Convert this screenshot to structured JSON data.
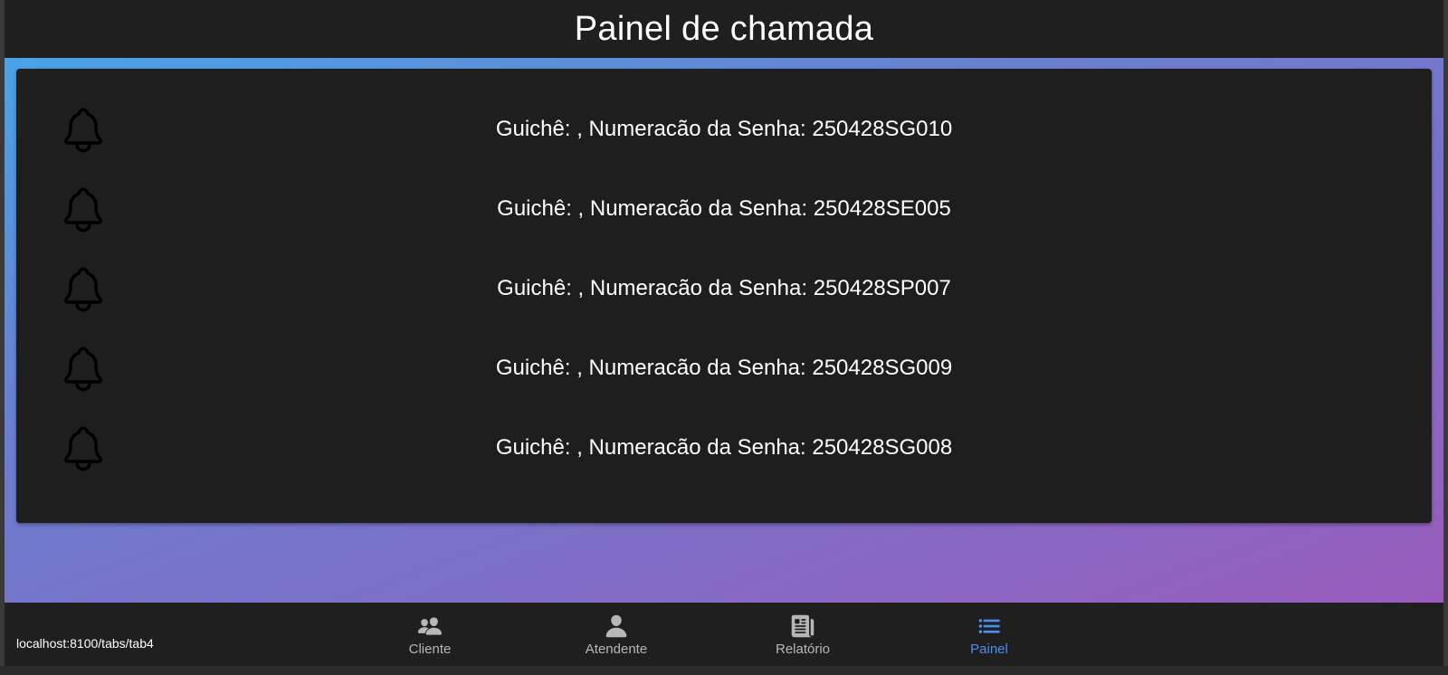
{
  "header": {
    "title": "Painel de chamada"
  },
  "calls": [
    {
      "text": "Guichê: , Numeracão da Senha: 250428SG010",
      "icon": "bell-icon"
    },
    {
      "text": "Guichê: , Numeracão da Senha: 250428SE005",
      "icon": "bell-icon"
    },
    {
      "text": "Guichê: , Numeracão da Senha: 250428SP007",
      "icon": "bell-icon"
    },
    {
      "text": "Guichê: , Numeracão da Senha: 250428SG009",
      "icon": "bell-icon"
    },
    {
      "text": "Guichê: , Numeracão da Senha: 250428SG008",
      "icon": "bell-icon"
    }
  ],
  "tabs": [
    {
      "label": "Cliente",
      "icon": "people-icon",
      "active": false
    },
    {
      "label": "Atendente",
      "icon": "person-icon",
      "active": false
    },
    {
      "label": "Relatório",
      "icon": "newspaper-icon",
      "active": false
    },
    {
      "label": "Painel",
      "icon": "list-icon",
      "active": true
    }
  ],
  "status_bar": {
    "url": "localhost:8100/tabs/tab4"
  },
  "colors": {
    "accent": "#4a8ff0",
    "background": "#1f1f1f",
    "card": "#1e1e1e",
    "gradient_start": "#4aa3e6",
    "gradient_end": "#9a5cbc"
  }
}
